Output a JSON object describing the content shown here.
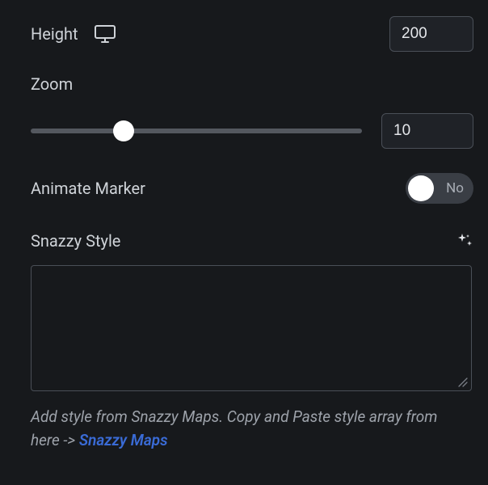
{
  "height": {
    "label": "Height",
    "value": "200"
  },
  "zoom": {
    "label": "Zoom",
    "value": "10",
    "slider_percent": 28
  },
  "animate": {
    "label": "Animate Marker",
    "state_label": "No"
  },
  "snazzy": {
    "label": "Snazzy Style",
    "value": ""
  },
  "helper": {
    "prefix": "Add style from Snazzy Maps. Copy and Paste style array from here -> ",
    "link_text": "Snazzy Maps"
  }
}
